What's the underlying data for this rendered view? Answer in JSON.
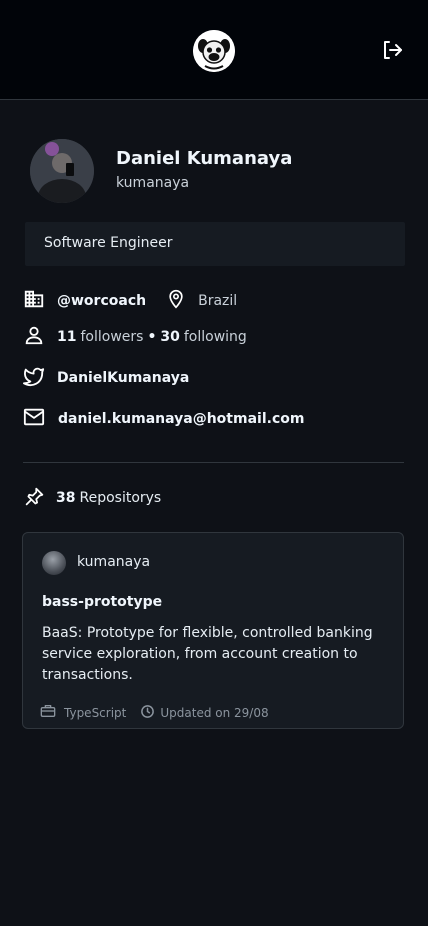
{
  "header": {
    "logo_icon": "pug-logo-icon",
    "logout_icon": "logout-icon"
  },
  "profile": {
    "name": "Daniel Kumanaya",
    "login": "kumanaya",
    "bio": "Software Engineer",
    "company": "@worcoach",
    "location": "Brazil",
    "followers_count": "11",
    "followers_label": "followers",
    "separator": "•",
    "following_count": "30",
    "following_label": "following",
    "twitter": "DanielKumanaya",
    "email": "daniel.kumanaya@hotmail.com"
  },
  "repos": {
    "count": "38",
    "label": "Repositorys"
  },
  "repo_card": {
    "owner": "kumanaya",
    "title": "bass-prototype",
    "description": "BaaS: Prototype for flexible, controlled banking service exploration, from account creation to transactions.",
    "language": "TypeScript",
    "updated": "Updated on 29/08"
  },
  "colors": {
    "background": "#0e1117",
    "topbar": "#010409",
    "card": "#161b22",
    "border": "#30363d",
    "text": "#e6edf3",
    "muted": "#8b949e"
  }
}
